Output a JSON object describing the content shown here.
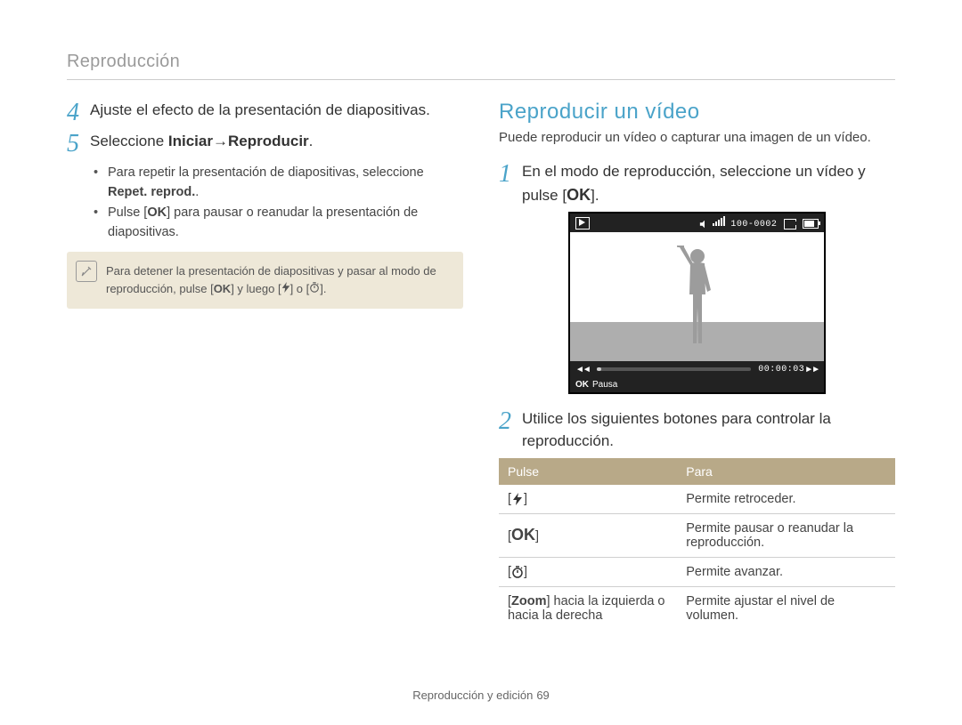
{
  "header": {
    "breadcrumb": "Reproducción"
  },
  "left": {
    "step4": {
      "num": "4",
      "text": "Ajuste el efecto de la presentación de diapositivas."
    },
    "step5": {
      "num": "5",
      "text_before": "Seleccione ",
      "bold1": "Iniciar",
      "arrow": " → ",
      "bold2": "Reproducir",
      "text_after": ".",
      "bullet1_a": "Para repetir la presentación de diapositivas, seleccione ",
      "bullet1_b": "Repet. reprod.",
      "bullet1_c": ".",
      "bullet2_a": "Pulse [",
      "bullet2_ok": "OK",
      "bullet2_b": "] para pausar o reanudar la presentación de diapositivas."
    },
    "note": {
      "line_a": "Para detener la presentación de diapositivas y pasar al modo de reproducción, pulse [",
      "ok": "OK",
      "line_b": "] y luego [",
      "line_c": "] o [",
      "line_d": "]."
    }
  },
  "right": {
    "title": "Reproducir un vídeo",
    "subtitle": "Puede reproducir un vídeo o capturar una imagen de un vídeo.",
    "step1": {
      "num": "1",
      "text_a": "En el modo de reproducción, seleccione un vídeo y pulse [",
      "ok": "OK",
      "text_b": "]."
    },
    "screen": {
      "counter": "100-0002",
      "time": "00:00:03",
      "ok": "OK",
      "pause": "Pausa"
    },
    "step2": {
      "num": "2",
      "text": "Utilice los siguientes botones para controlar la reproducción."
    },
    "table": {
      "head_pulse": "Pulse",
      "head_para": "Para",
      "row1_para": "Permite retroceder.",
      "row2_ok": "OK",
      "row2_para": "Permite pausar o reanudar la reproducción.",
      "row3_para": "Permite avanzar.",
      "row4_pulse_a": "[",
      "row4_pulse_bold": "Zoom",
      "row4_pulse_b": "] hacia la izquierda o hacia la derecha",
      "row4_para": "Permite ajustar el nivel de volumen."
    }
  },
  "footer": {
    "section": "Reproducción y edición",
    "page": "69"
  }
}
